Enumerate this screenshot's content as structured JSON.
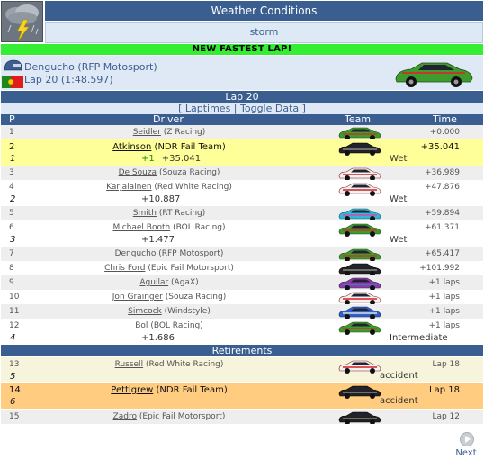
{
  "weather": {
    "title": "Weather Conditions",
    "value": "storm",
    "icon": "storm-icon"
  },
  "fastest_lap": {
    "banner": "NEW FASTEST LAP!",
    "driver": "Dengucho (RFP Motosport)",
    "lap": "Lap 20 (1:48.597)",
    "flag": "portugal-flag-icon",
    "helmet": "helmet-icon"
  },
  "lap_header": "Lap 20",
  "links": {
    "open": "[ ",
    "laptimes": "Laptimes",
    "sep": " | ",
    "toggle": "Toggle Data",
    "close": " ]"
  },
  "columns": {
    "pos": "P",
    "driver": "Driver",
    "team": "Team",
    "time": "Time"
  },
  "rows": [
    {
      "pos": "1",
      "name": "Seidler",
      "team": "(Z Racing)",
      "time": "+0.000",
      "car": "green-car-icon"
    },
    {
      "pos": "2",
      "name": "Atkinson",
      "team": "(NDR Fail Team)",
      "time": "+35.041",
      "gain": "1",
      "gain_change": "+1",
      "delta": "+35.041",
      "tyre": "Wet",
      "car": "black-car-icon"
    },
    {
      "pos": "3",
      "name": "De Souza",
      "team": "(Souza Racing)",
      "time": "+36.989",
      "car": "red-white-car-icon"
    },
    {
      "pos": "4",
      "name": "Karjalainen",
      "team": "(Red White Racing)",
      "time": "+47.876",
      "gain": "2",
      "delta": "+10.887",
      "tyre": "Wet",
      "car": "red-white-car-icon"
    },
    {
      "pos": "5",
      "name": "Smith",
      "team": "(RT Racing)",
      "time": "+59.894",
      "car": "cyan-car-icon"
    },
    {
      "pos": "6",
      "name": "Michael Booth",
      "team": "(BOL Racing)",
      "time": "+61.371",
      "gain": "3",
      "delta": "+1.477",
      "tyre": "Wet",
      "car": "green-car-icon"
    },
    {
      "pos": "7",
      "name": "Dengucho",
      "team": "(RFP Motosport)",
      "time": "+65.417",
      "car": "green-car-icon"
    },
    {
      "pos": "8",
      "name": "Chris Ford",
      "team": "(Epic Fail Motorsport)",
      "time": "+101.992",
      "car": "black-car-icon"
    },
    {
      "pos": "9",
      "name": "Aguilar",
      "team": "(AgaX)",
      "time": "+1 laps",
      "car": "purple-car-icon"
    },
    {
      "pos": "10",
      "name": "Jon Grainger",
      "team": "(Souza Racing)",
      "time": "+1 laps",
      "car": "red-white-car-icon"
    },
    {
      "pos": "11",
      "name": "Simcock",
      "team": "(Windstyle)",
      "time": "+1 laps",
      "car": "blue-car-icon"
    },
    {
      "pos": "12",
      "name": "Bol",
      "team": "(BOL Racing)",
      "time": "+1 laps",
      "gain": "4",
      "delta": "+1.686",
      "tyre": "Intermediate",
      "car": "green-car-icon"
    }
  ],
  "retirements_header": "Retirements",
  "retirements": [
    {
      "pos": "13",
      "name": "Russell",
      "team": "(Red White Racing)",
      "time": "Lap 18",
      "gain": "5",
      "reason": "accident",
      "car": "red-white-car-icon"
    },
    {
      "pos": "14",
      "name": "Pettigrew",
      "team": "(NDR Fail Team)",
      "time": "Lap 18",
      "gain": "6",
      "reason": "accident",
      "car": "black-car-icon"
    },
    {
      "pos": "15",
      "name": "Zadro",
      "team": "(Epic Fail Motorsport)",
      "time": "Lap 12",
      "car": "black-car-icon"
    }
  ],
  "next": "Next",
  "colors": {
    "header": "#3b5e91",
    "fastest": "#33ee33",
    "highlight": "#ffff99",
    "retire_highlight": "#ffcc80"
  }
}
